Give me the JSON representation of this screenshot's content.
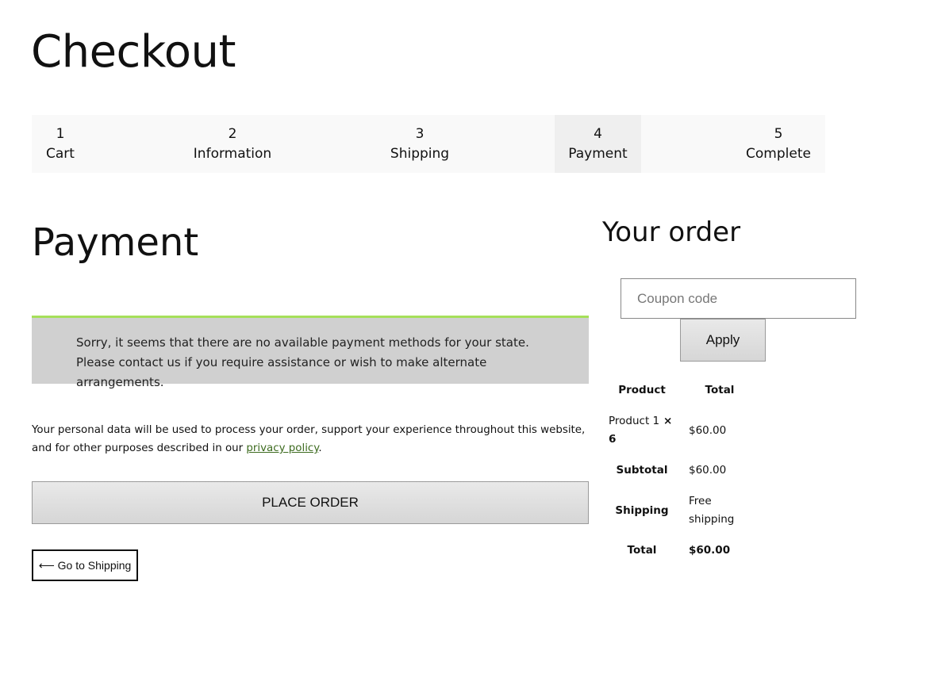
{
  "page": {
    "title": "Checkout"
  },
  "steps": [
    {
      "number": "1",
      "label": "Cart"
    },
    {
      "number": "2",
      "label": "Information"
    },
    {
      "number": "3",
      "label": "Shipping"
    },
    {
      "number": "4",
      "label": "Payment",
      "active": true
    },
    {
      "number": "5",
      "label": "Complete"
    }
  ],
  "payment": {
    "heading": "Payment",
    "notice": "Sorry, it seems that there are no available payment methods for your state. Please contact us if you require assistance or wish to make alternate arrangements.",
    "privacy_text_before": "Your personal data will be used to process your order, support your experience throughout this website, and for other purposes described in our ",
    "privacy_link": "privacy policy",
    "privacy_text_after": ".",
    "place_order_label": "PLACE ORDER",
    "back_label": "⟵ Go to Shipping"
  },
  "order": {
    "heading": "Your order",
    "coupon_placeholder": "Coupon code",
    "apply_label": "Apply",
    "col_product": "Product",
    "col_total": "Total",
    "item_name": "Product 1",
    "item_times": "×",
    "item_qty": "6",
    "item_total": "$60.00",
    "subtotal_label": "Subtotal",
    "subtotal_value": "$60.00",
    "shipping_label": "Shipping",
    "shipping_value": "Free shipping",
    "total_label": "Total",
    "total_value": "$60.00"
  },
  "colors": {
    "notice_accent": "#a6e05a",
    "link": "#3d6b1f",
    "notice_bg": "#d0d0d0"
  }
}
